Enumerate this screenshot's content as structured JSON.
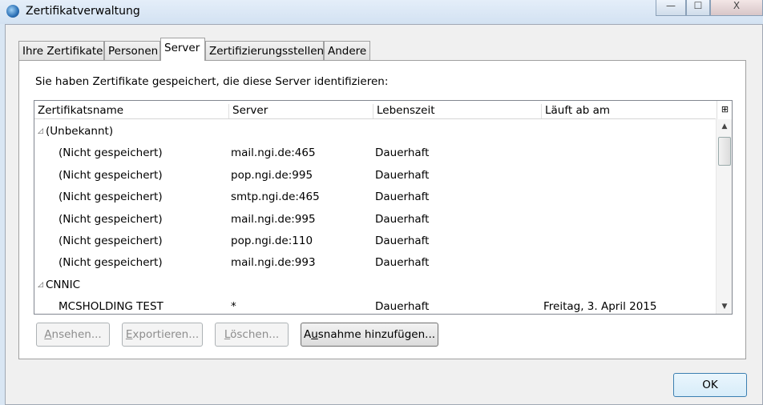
{
  "window": {
    "title": "Zertifikatverwaltung",
    "minimize": "—",
    "maximize": "☐",
    "close": "X"
  },
  "tabs": [
    {
      "label": "Ihre Zertifikate"
    },
    {
      "label": "Personen"
    },
    {
      "label": "Server",
      "active": true
    },
    {
      "label": "Zertifizierungsstellen"
    },
    {
      "label": "Andere"
    }
  ],
  "intro": "Sie haben Zertifikate gespeichert, die diese Server identifizieren:",
  "columns": [
    "Zertifikatsname",
    "Server",
    "Lebenszeit",
    "Läuft ab am"
  ],
  "rows": [
    {
      "type": "group",
      "name": "(Unbekannt)",
      "toggle": "◿"
    },
    {
      "name": "(Nicht gespeichert)",
      "server": "mail.ngi.de:465",
      "life": "Dauerhaft",
      "expires": ""
    },
    {
      "name": "(Nicht gespeichert)",
      "server": "pop.ngi.de:995",
      "life": "Dauerhaft",
      "expires": ""
    },
    {
      "name": "(Nicht gespeichert)",
      "server": "smtp.ngi.de:465",
      "life": "Dauerhaft",
      "expires": ""
    },
    {
      "name": "(Nicht gespeichert)",
      "server": "mail.ngi.de:995",
      "life": "Dauerhaft",
      "expires": ""
    },
    {
      "name": "(Nicht gespeichert)",
      "server": "pop.ngi.de:110",
      "life": "Dauerhaft",
      "expires": ""
    },
    {
      "name": "(Nicht gespeichert)",
      "server": "mail.ngi.de:993",
      "life": "Dauerhaft",
      "expires": ""
    },
    {
      "type": "group",
      "name": "CNNIC",
      "toggle": "◿"
    },
    {
      "name": "MCSHOLDING TEST",
      "server": "*",
      "life": "Dauerhaft",
      "expires": "Freitag, 3. April 2015"
    }
  ],
  "buttons": {
    "view": {
      "accel": "A",
      "rest": "nsehen..."
    },
    "export": {
      "accel": "E",
      "rest": "xportieren..."
    },
    "delete": {
      "accel": "L",
      "rest": "öschen..."
    },
    "add_exception": {
      "pre": "A",
      "accel": "u",
      "rest": "snahme hinzufügen..."
    },
    "ok": "OK"
  }
}
